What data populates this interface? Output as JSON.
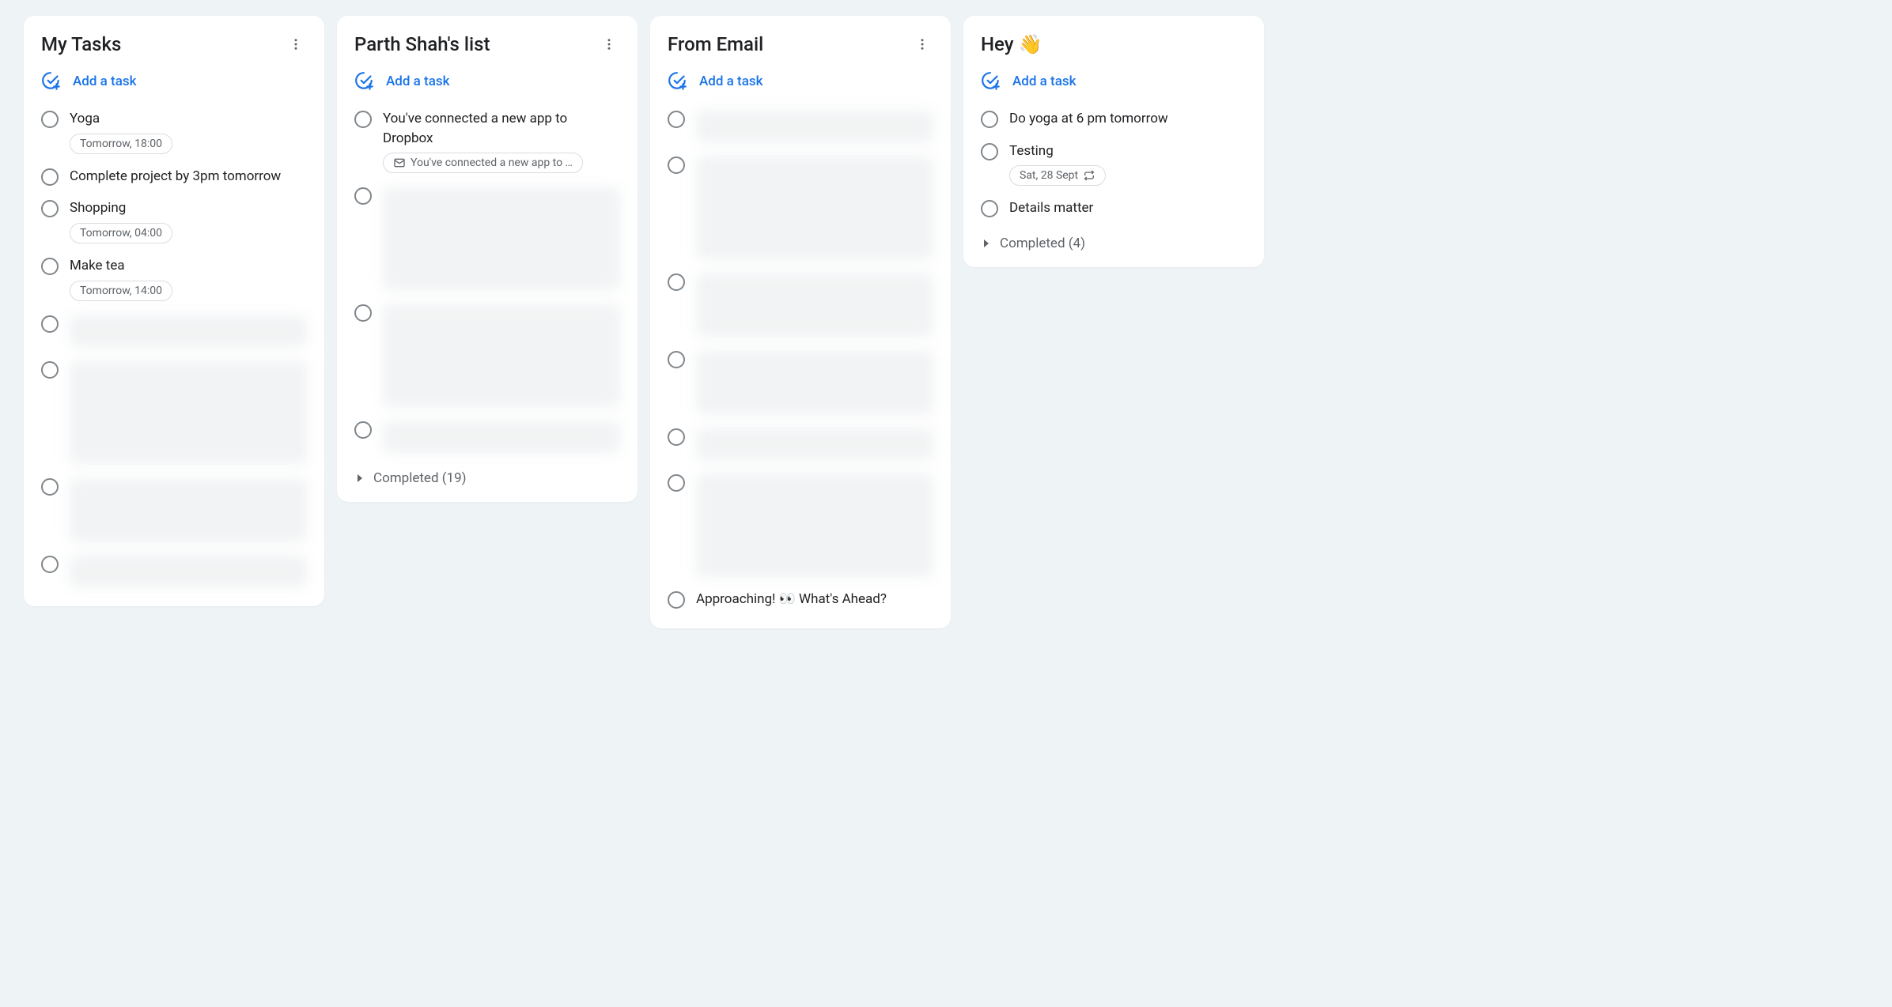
{
  "addTaskLabel": "Add a task",
  "lists": [
    {
      "title": "My Tasks",
      "hasMenu": true,
      "tasks": [
        {
          "title": "Yoga",
          "chip": {
            "type": "date",
            "text": "Tomorrow, 18:00"
          }
        },
        {
          "title": "Complete project by 3pm tomorrow"
        },
        {
          "title": "Shopping",
          "chip": {
            "type": "date",
            "text": "Tomorrow, 04:00"
          }
        },
        {
          "title": "Make tea",
          "chip": {
            "type": "date",
            "text": "Tomorrow, 14:00"
          }
        },
        {
          "blurred": true,
          "height": "short"
        },
        {
          "blurred": true,
          "height": "tall"
        },
        {
          "blurred": true,
          "height": "med"
        },
        {
          "blurred": true,
          "height": "short"
        }
      ]
    },
    {
      "title": "Parth Shah's list",
      "hasMenu": true,
      "tasks": [
        {
          "title": "You've connected a new app to Dropbox",
          "chip": {
            "type": "email",
            "text": "You've connected a new app to …"
          }
        },
        {
          "blurred": true,
          "height": "tall"
        },
        {
          "blurred": true,
          "height": "tall"
        },
        {
          "blurred": true,
          "height": "short"
        }
      ],
      "completed": "Completed (19)"
    },
    {
      "title": "From Email",
      "hasMenu": true,
      "tasks": [
        {
          "blurred": true,
          "height": "short"
        },
        {
          "blurred": true,
          "height": "tall"
        },
        {
          "blurred": true,
          "height": "med"
        },
        {
          "blurred": true,
          "height": "med"
        },
        {
          "blurred": true,
          "height": "short"
        },
        {
          "blurred": true,
          "height": "tall"
        },
        {
          "title": "Approaching! 👀 What's Ahead?"
        }
      ]
    },
    {
      "title": "Hey 👋",
      "hasMenu": false,
      "tasks": [
        {
          "title": "Do yoga at 6 pm tomorrow"
        },
        {
          "title": "Testing",
          "chip": {
            "type": "repeat",
            "text": "Sat, 28 Sept"
          }
        },
        {
          "title": "Details matter"
        }
      ],
      "completed": "Completed (4)"
    }
  ]
}
